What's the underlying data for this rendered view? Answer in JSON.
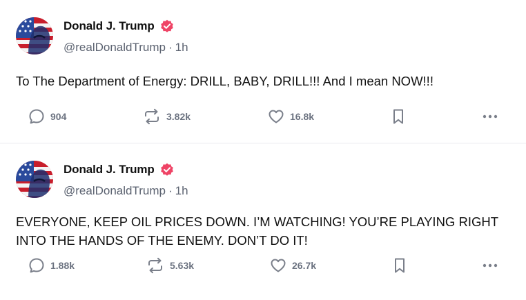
{
  "posts": [
    {
      "author": {
        "name": "Donald J. Trump",
        "handle": "@realDonaldTrump",
        "separator": "·",
        "time": "1h"
      },
      "text": "To The Department of Energy: DRILL, BABY, DRILL!!!  And I mean NOW!!!",
      "stats": {
        "replies": "904",
        "reposts": "3.82k",
        "likes": "16.8k"
      }
    },
    {
      "author": {
        "name": "Donald J. Trump",
        "handle": "@realDonaldTrump",
        "separator": "·",
        "time": "1h"
      },
      "text": "EVERYONE, KEEP OIL PRICES DOWN. I’M WATCHING! YOU’RE PLAYING RIGHT INTO THE HANDS OF THE ENEMY. DON’T DO IT!",
      "stats": {
        "replies": "1.88k",
        "reposts": "5.63k",
        "likes": "26.7k"
      }
    }
  ],
  "colors": {
    "verified_badge": "#ef4466",
    "icon": "#7a7f8a",
    "count": "#6b7280"
  },
  "icons": [
    "verified-badge-icon",
    "reply-icon",
    "repost-icon",
    "like-icon",
    "bookmark-icon",
    "more-icon"
  ]
}
